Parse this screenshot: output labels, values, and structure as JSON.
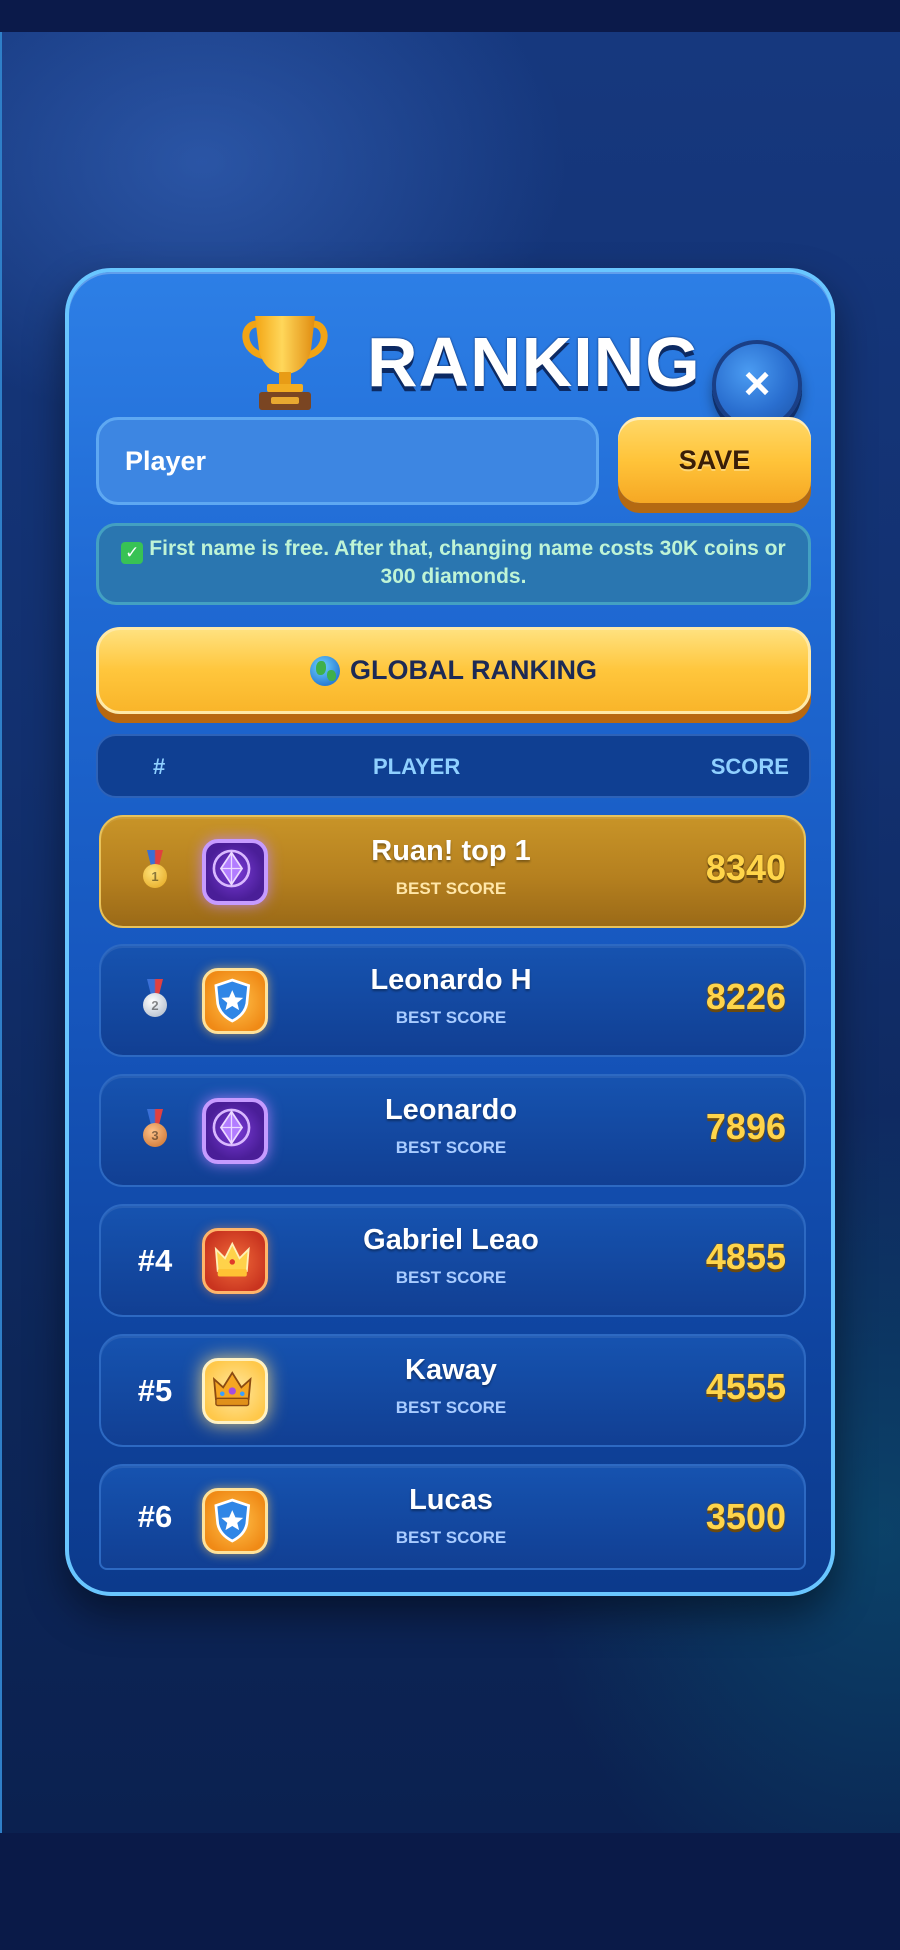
{
  "title": "RANKING",
  "close_label": "×",
  "name_input": {
    "value": "Player",
    "placeholder": ""
  },
  "save_label": "SAVE",
  "notice": "First name is free. After that, changing name costs 30K coins or 300 diamonds.",
  "global_ranking_label": "GLOBAL RANKING",
  "table_header": {
    "rank": "#",
    "player": "PLAYER",
    "score": "SCORE"
  },
  "best_score_label": "BEST SCORE",
  "rows": [
    {
      "rank": "1",
      "medal": "gold-medal-icon",
      "avatar": "purple-crystal-avatar-icon",
      "name": "Ruan! top 1",
      "score": "8340"
    },
    {
      "rank": "2",
      "medal": "silver-medal-icon",
      "avatar": "blue-star-shield-avatar-icon",
      "name": "Leonardo H",
      "score": "8226"
    },
    {
      "rank": "3",
      "medal": "bronze-medal-icon",
      "avatar": "purple-crystal-avatar-icon",
      "name": "Leonardo",
      "score": "7896"
    },
    {
      "rank": "#4",
      "avatar": "red-crown-avatar-icon",
      "name": "Gabriel Leao",
      "score": "4855"
    },
    {
      "rank": "#5",
      "avatar": "gold-crown-avatar-icon",
      "name": "Kaway",
      "score": "4555"
    },
    {
      "rank": "#6",
      "avatar": "blue-star-shield-avatar-icon",
      "name": "Lucas",
      "score": "3500"
    }
  ],
  "colors": {
    "accent_gold": "#ffc43a",
    "score": "#ffd54a",
    "panel_border": "#69c6ff"
  }
}
